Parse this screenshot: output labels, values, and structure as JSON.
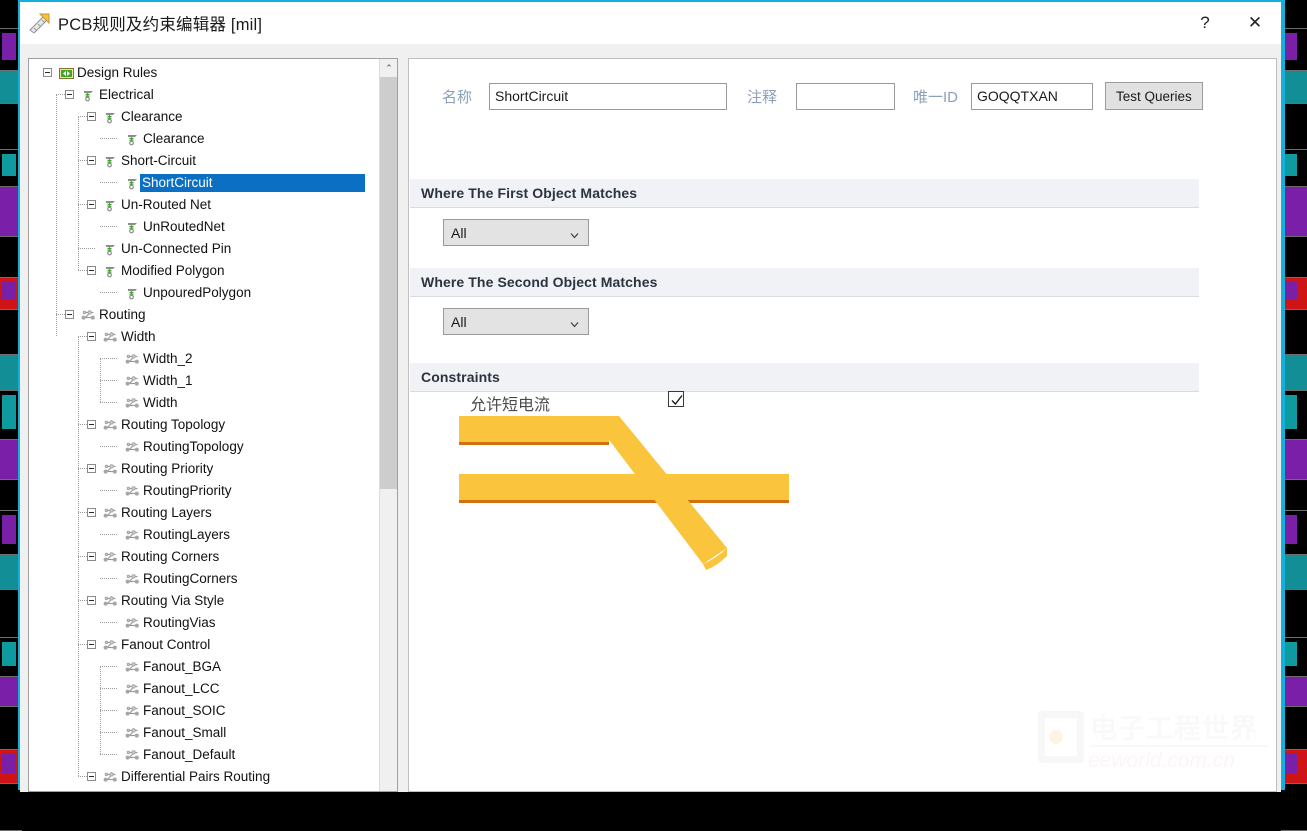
{
  "window": {
    "title": "PCB规则及约束编辑器 [mil]",
    "icon": "ruler-icon",
    "help_label": "?",
    "close_label": "✕",
    "accent_color": "#12b0dd"
  },
  "tree": {
    "scroll_up_label": "⌃",
    "nodes": [
      {
        "label": "Design Rules",
        "depth": 0,
        "icon": "design-rules-icon",
        "expander": "minus",
        "selected": false
      },
      {
        "label": "Electrical",
        "depth": 1,
        "icon": "electrical-icon",
        "expander": "minus",
        "selected": false
      },
      {
        "label": "Clearance",
        "depth": 2,
        "icon": "electrical-icon",
        "expander": "minus",
        "selected": false
      },
      {
        "label": "Clearance",
        "depth": 3,
        "icon": "electrical-icon",
        "expander": "none",
        "selected": false
      },
      {
        "label": "Short-Circuit",
        "depth": 2,
        "icon": "electrical-icon",
        "expander": "minus",
        "selected": false
      },
      {
        "label": "ShortCircuit",
        "depth": 3,
        "icon": "electrical-icon",
        "expander": "none",
        "selected": true
      },
      {
        "label": "Un-Routed Net",
        "depth": 2,
        "icon": "electrical-icon",
        "expander": "minus",
        "selected": false
      },
      {
        "label": "UnRoutedNet",
        "depth": 3,
        "icon": "electrical-icon",
        "expander": "none",
        "selected": false
      },
      {
        "label": "Un-Connected Pin",
        "depth": 2,
        "icon": "electrical-icon",
        "expander": "none",
        "selected": false
      },
      {
        "label": "Modified Polygon",
        "depth": 2,
        "icon": "electrical-icon",
        "expander": "minus",
        "selected": false
      },
      {
        "label": "UnpouredPolygon",
        "depth": 3,
        "icon": "electrical-icon",
        "expander": "none",
        "selected": false
      },
      {
        "label": "Routing",
        "depth": 1,
        "icon": "routing-icon",
        "expander": "minus",
        "selected": false
      },
      {
        "label": "Width",
        "depth": 2,
        "icon": "routing-icon",
        "expander": "minus",
        "selected": false
      },
      {
        "label": "Width_2",
        "depth": 3,
        "icon": "routing-icon",
        "expander": "none",
        "selected": false
      },
      {
        "label": "Width_1",
        "depth": 3,
        "icon": "routing-icon",
        "expander": "none",
        "selected": false
      },
      {
        "label": "Width",
        "depth": 3,
        "icon": "routing-icon",
        "expander": "none",
        "selected": false
      },
      {
        "label": "Routing Topology",
        "depth": 2,
        "icon": "routing-icon",
        "expander": "minus",
        "selected": false
      },
      {
        "label": "RoutingTopology",
        "depth": 3,
        "icon": "routing-icon",
        "expander": "none",
        "selected": false
      },
      {
        "label": "Routing Priority",
        "depth": 2,
        "icon": "routing-icon",
        "expander": "minus",
        "selected": false
      },
      {
        "label": "RoutingPriority",
        "depth": 3,
        "icon": "routing-icon",
        "expander": "none",
        "selected": false
      },
      {
        "label": "Routing Layers",
        "depth": 2,
        "icon": "routing-icon",
        "expander": "minus",
        "selected": false
      },
      {
        "label": "RoutingLayers",
        "depth": 3,
        "icon": "routing-icon",
        "expander": "none",
        "selected": false
      },
      {
        "label": "Routing Corners",
        "depth": 2,
        "icon": "routing-icon",
        "expander": "minus",
        "selected": false
      },
      {
        "label": "RoutingCorners",
        "depth": 3,
        "icon": "routing-icon",
        "expander": "none",
        "selected": false
      },
      {
        "label": "Routing Via Style",
        "depth": 2,
        "icon": "routing-icon",
        "expander": "minus",
        "selected": false
      },
      {
        "label": "RoutingVias",
        "depth": 3,
        "icon": "routing-icon",
        "expander": "none",
        "selected": false
      },
      {
        "label": "Fanout Control",
        "depth": 2,
        "icon": "routing-icon",
        "expander": "minus",
        "selected": false
      },
      {
        "label": "Fanout_BGA",
        "depth": 3,
        "icon": "routing-icon",
        "expander": "none",
        "selected": false
      },
      {
        "label": "Fanout_LCC",
        "depth": 3,
        "icon": "routing-icon",
        "expander": "none",
        "selected": false
      },
      {
        "label": "Fanout_SOIC",
        "depth": 3,
        "icon": "routing-icon",
        "expander": "none",
        "selected": false
      },
      {
        "label": "Fanout_Small",
        "depth": 3,
        "icon": "routing-icon",
        "expander": "none",
        "selected": false
      },
      {
        "label": "Fanout_Default",
        "depth": 3,
        "icon": "routing-icon",
        "expander": "none",
        "selected": false
      },
      {
        "label": "Differential Pairs Routing",
        "depth": 2,
        "icon": "routing-icon",
        "expander": "minus",
        "selected": false
      }
    ]
  },
  "form": {
    "name_label": "名称",
    "name_value": "ShortCircuit",
    "comment_label": "注释",
    "comment_value": "",
    "unique_id_label": "唯一ID",
    "unique_id_value": "GOQQTXAN",
    "test_queries_label": "Test Queries"
  },
  "sections": {
    "first_object": {
      "title": "Where The First Object Matches",
      "scope_value": "All"
    },
    "second_object": {
      "title": "Where The Second Object Matches",
      "scope_value": "All"
    },
    "constraints": {
      "title": "Constraints",
      "allow_short_circuit_label": "允许短电流",
      "allow_short_circuit_checked": true
    }
  },
  "watermark": {
    "cn_text": "电子工程世界",
    "en_text": "eeworld.com.cn"
  }
}
